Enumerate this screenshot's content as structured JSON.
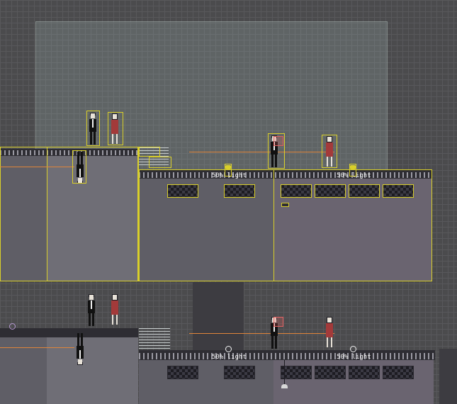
{
  "scene": {
    "light_labels": [
      "50% light",
      "50% light",
      "50% light",
      "50% light"
    ]
  },
  "colors": {
    "selection": "#d9cf2a",
    "laser": "#e0853a",
    "building": "#5f5e66",
    "grid": "#58585b",
    "background": "#4b4b4d"
  },
  "icons": [
    "guard-man-icon",
    "woman-red-dress-icon",
    "hanging-man-icon",
    "stairs-icon",
    "ceiling-lamp-icon",
    "light-ring-icon",
    "target-reticle-icon"
  ]
}
